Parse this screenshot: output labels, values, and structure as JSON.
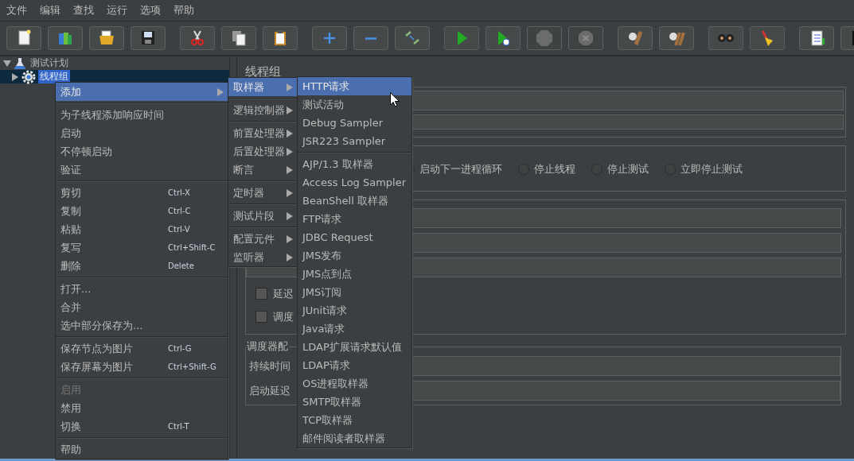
{
  "menu_bar": [
    {
      "label": "文件"
    },
    {
      "label": "编辑"
    },
    {
      "label": "查找"
    },
    {
      "label": "运行"
    },
    {
      "label": "选项"
    },
    {
      "label": "帮助"
    }
  ],
  "toolbar": [
    {
      "kind": "new",
      "disabled": false
    },
    {
      "kind": "templates",
      "disabled": false
    },
    {
      "kind": "open",
      "disabled": false
    },
    {
      "kind": "save",
      "disabled": false
    },
    {
      "kind": "cut",
      "disabled": false
    },
    {
      "kind": "copy",
      "disabled": false
    },
    {
      "kind": "paste",
      "disabled": false
    },
    {
      "kind": "expand",
      "disabled": false
    },
    {
      "kind": "collapse",
      "disabled": false
    },
    {
      "kind": "toggle",
      "disabled": false
    },
    {
      "kind": "start",
      "disabled": false
    },
    {
      "kind": "start_no_pause",
      "disabled": false
    },
    {
      "kind": "stop",
      "disabled": true
    },
    {
      "kind": "shutdown",
      "disabled": true
    },
    {
      "kind": "clear",
      "disabled": false
    },
    {
      "kind": "clear_all",
      "disabled": false
    },
    {
      "kind": "search",
      "disabled": false
    },
    {
      "kind": "reset_search",
      "disabled": false
    },
    {
      "kind": "function_helper",
      "disabled": false
    },
    {
      "kind": "log",
      "disabled": false
    }
  ],
  "tree": [
    {
      "label": "测试计划",
      "expanded": true,
      "selected": false,
      "kind": "plan",
      "children": [
        {
          "label": "线程组",
          "expanded": false,
          "selected": true,
          "kind": "thread_group"
        }
      ]
    }
  ],
  "panel": {
    "title": "线程组",
    "error_actions": [
      {
        "label": "启动下一进程循环",
        "selected": false
      },
      {
        "label": "停止线程",
        "selected": false
      },
      {
        "label": "停止测试",
        "selected": false
      },
      {
        "label": "立即停止测试",
        "selected": false
      }
    ],
    "checkboxes": [
      {
        "label": "延迟",
        "checked": false
      },
      {
        "label": "调度",
        "checked": false
      }
    ],
    "scheduler": {
      "legend": "调度器配",
      "fields": [
        {
          "label": "持续时间"
        },
        {
          "label": "启动延迟"
        }
      ]
    }
  },
  "popups": [
    {
      "groups": [
        [
          {
            "label": "添加",
            "submenu": true,
            "selected": true,
            "disabled": false
          }
        ],
        [
          {
            "label": "为子线程添加响应时间",
            "submenu": false,
            "selected": false,
            "disabled": false
          },
          {
            "label": "启动",
            "submenu": false,
            "selected": false,
            "disabled": false
          },
          {
            "label": "不停顿启动",
            "submenu": false,
            "selected": false,
            "disabled": false
          },
          {
            "label": "验证",
            "submenu": false,
            "selected": false,
            "disabled": false
          }
        ],
        [
          {
            "label": "剪切",
            "shortcut": "Ctrl-X",
            "submenu": false,
            "selected": false,
            "disabled": false
          },
          {
            "label": "复制",
            "shortcut": "Ctrl-C",
            "submenu": false,
            "selected": false,
            "disabled": false
          },
          {
            "label": "粘贴",
            "shortcut": "Ctrl-V",
            "submenu": false,
            "selected": false,
            "disabled": false
          },
          {
            "label": "复写",
            "shortcut": "Ctrl+Shift-C",
            "submenu": false,
            "selected": false,
            "disabled": false
          },
          {
            "label": "删除",
            "shortcut": "Delete",
            "submenu": false,
            "selected": false,
            "disabled": false
          }
        ],
        [
          {
            "label": "打开...",
            "submenu": false,
            "selected": false,
            "disabled": false
          },
          {
            "label": "合并",
            "submenu": false,
            "selected": false,
            "disabled": false
          },
          {
            "label": "选中部分保存为...",
            "submenu": false,
            "selected": false,
            "disabled": false
          }
        ],
        [
          {
            "label": "保存节点为图片",
            "shortcut": "Ctrl-G",
            "submenu": false,
            "selected": false,
            "disabled": false
          },
          {
            "label": "保存屏幕为图片",
            "shortcut": "Ctrl+Shift-G",
            "submenu": false,
            "selected": false,
            "disabled": false
          }
        ],
        [
          {
            "label": "启用",
            "submenu": false,
            "selected": false,
            "disabled": true
          },
          {
            "label": "禁用",
            "submenu": false,
            "selected": false,
            "disabled": false
          },
          {
            "label": "切换",
            "shortcut": "Ctrl-T",
            "submenu": false,
            "selected": false,
            "disabled": false
          }
        ],
        [
          {
            "label": "帮助",
            "submenu": false,
            "selected": false,
            "disabled": false
          }
        ]
      ]
    },
    {
      "groups": [
        [
          {
            "label": "取样器",
            "submenu": true,
            "selected": true
          }
        ],
        [
          {
            "label": "逻辑控制器",
            "submenu": true,
            "selected": false
          }
        ],
        [
          {
            "label": "前置处理器",
            "submenu": true,
            "selected": false
          },
          {
            "label": "后置处理器",
            "submenu": true,
            "selected": false
          },
          {
            "label": "断言",
            "submenu": true,
            "selected": false
          }
        ],
        [
          {
            "label": "定时器",
            "submenu": true,
            "selected": false
          }
        ],
        [
          {
            "label": "测试片段",
            "submenu": true,
            "selected": false
          }
        ],
        [
          {
            "label": "配置元件",
            "submenu": true,
            "selected": false
          },
          {
            "label": "监听器",
            "submenu": true,
            "selected": false
          }
        ]
      ]
    },
    {
      "groups": [
        [
          {
            "label": "HTTP请求",
            "selected": true
          },
          {
            "label": "测试活动",
            "selected": false
          },
          {
            "label": "Debug Sampler",
            "selected": false
          },
          {
            "label": "JSR223 Sampler",
            "selected": false
          }
        ],
        [
          {
            "label": "AJP/1.3 取样器",
            "selected": false
          },
          {
            "label": "Access Log Sampler",
            "selected": false
          },
          {
            "label": "BeanShell 取样器",
            "selected": false
          },
          {
            "label": "FTP请求",
            "selected": false
          },
          {
            "label": "JDBC Request",
            "selected": false
          },
          {
            "label": "JMS发布",
            "selected": false
          },
          {
            "label": "JMS点到点",
            "selected": false
          },
          {
            "label": "JMS订阅",
            "selected": false
          },
          {
            "label": "JUnit请求",
            "selected": false
          },
          {
            "label": "Java请求",
            "selected": false
          },
          {
            "label": "LDAP扩展请求默认值",
            "selected": false
          },
          {
            "label": "LDAP请求",
            "selected": false
          },
          {
            "label": "OS进程取样器",
            "selected": false
          },
          {
            "label": "SMTP取样器",
            "selected": false
          },
          {
            "label": "TCP取样器",
            "selected": false
          },
          {
            "label": "邮件阅读者取样器",
            "selected": false
          }
        ]
      ]
    }
  ]
}
